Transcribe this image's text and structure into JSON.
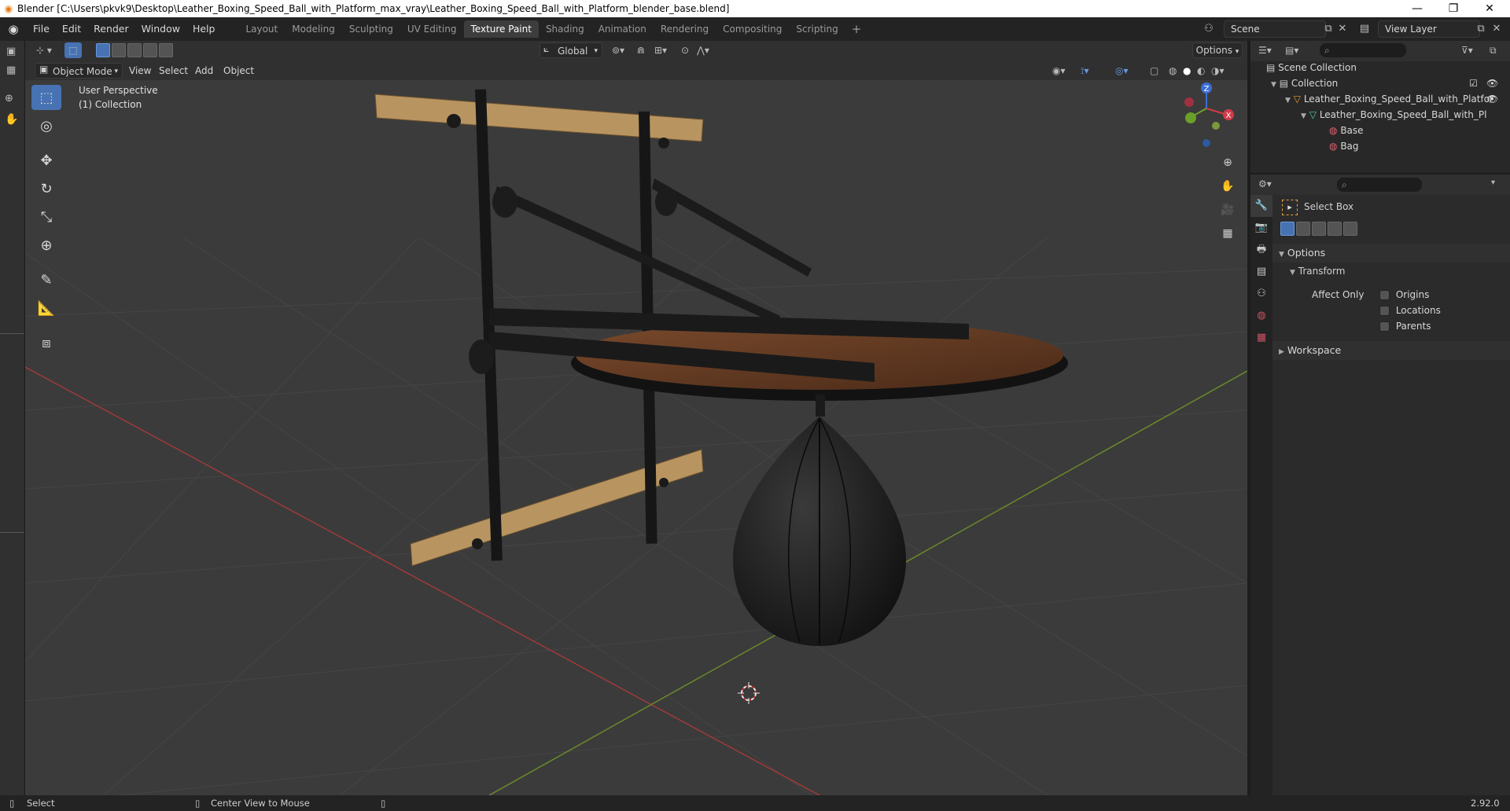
{
  "window": {
    "title": "Blender [C:\\Users\\pkvk9\\Desktop\\Leather_Boxing_Speed_Ball_with_Platform_max_vray\\Leather_Boxing_Speed_Ball_with_Platform_blender_base.blend]",
    "minimize": "—",
    "restore": "❐",
    "close": "✕"
  },
  "menu": [
    "File",
    "Edit",
    "Render",
    "Window",
    "Help"
  ],
  "workspaces": [
    {
      "label": "Layout",
      "active": false
    },
    {
      "label": "Modeling",
      "active": false
    },
    {
      "label": "Sculpting",
      "active": false
    },
    {
      "label": "UV Editing",
      "active": false
    },
    {
      "label": "Texture Paint",
      "active": true
    },
    {
      "label": "Shading",
      "active": false
    },
    {
      "label": "Animation",
      "active": false
    },
    {
      "label": "Rendering",
      "active": false
    },
    {
      "label": "Compositing",
      "active": false
    },
    {
      "label": "Scripting",
      "active": false
    }
  ],
  "workspace_add": "+",
  "scene": {
    "label": "Scene"
  },
  "view_layer": {
    "label": "View Layer"
  },
  "viewport_header": {
    "mode": "Object Mode",
    "menus": [
      "View",
      "Select",
      "Add",
      "Object"
    ],
    "transform_orientation": "Global",
    "options": "Options"
  },
  "viewport": {
    "perspective": "User Perspective",
    "collection": "(1) Collection",
    "gizmo": {
      "z": "Z",
      "y": "Y",
      "x": "X"
    }
  },
  "tools": [
    {
      "name": "select-box-tool",
      "glyph": "⬚",
      "active": true
    },
    {
      "name": "cursor-tool",
      "glyph": "◎",
      "active": false
    },
    {
      "name": "move-tool",
      "glyph": "✥",
      "active": false
    },
    {
      "name": "rotate-tool",
      "glyph": "↻",
      "active": false
    },
    {
      "name": "scale-tool",
      "glyph": "⤡",
      "active": false
    },
    {
      "name": "transform-tool",
      "glyph": "⊕",
      "active": false
    },
    {
      "name": "annotate-tool",
      "glyph": "✎",
      "active": false
    },
    {
      "name": "measure-tool",
      "glyph": "📐",
      "active": false
    },
    {
      "name": "add-cube-tool",
      "glyph": "⧈",
      "active": false
    }
  ],
  "outliner": {
    "scene_collection": "Scene Collection",
    "collection": "Collection",
    "object": "Leather_Boxing_Speed_Ball_with_Platfor",
    "mesh": "Leather_Boxing_Speed_Ball_with_Pl",
    "materials": [
      "Base",
      "Bag"
    ]
  },
  "properties": {
    "tool_name": "Select Box",
    "options_label": "Options",
    "transform_label": "Transform",
    "affect_only": "Affect Only",
    "checkboxes": [
      "Origins",
      "Locations",
      "Parents"
    ],
    "workspace_label": "Workspace"
  },
  "statusbar": {
    "left": "Select",
    "middle": "Center View to Mouse",
    "version": "2.92.0"
  }
}
